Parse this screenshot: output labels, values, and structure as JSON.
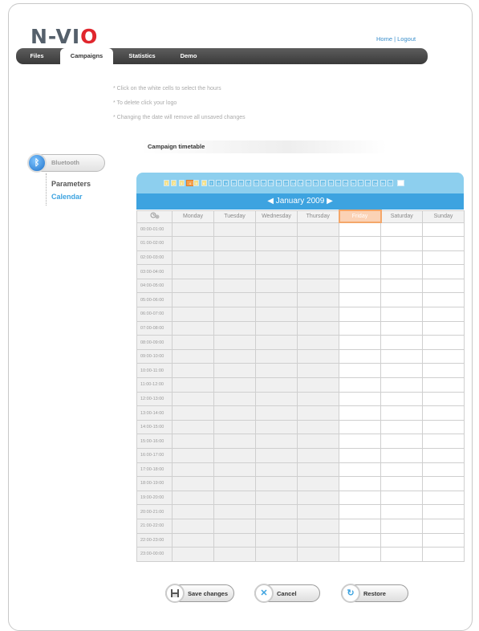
{
  "logo": {
    "pre": "N-VI",
    "o": "O"
  },
  "toplinks": {
    "home": "Home",
    "sep": " | ",
    "logout": "Logout"
  },
  "nav": {
    "tabs": [
      {
        "label": "Files"
      },
      {
        "label": "Campaigns"
      },
      {
        "label": "Statistics"
      },
      {
        "label": "Demo"
      }
    ],
    "active": "Campaigns"
  },
  "hints": [
    "* Click on the white cells to select the hours",
    "* To delete click your logo",
    "* Changing the date will remove all unsaved changes"
  ],
  "sidebar": {
    "pill_label": "Bluetooth",
    "items": [
      {
        "label": "Parameters"
      },
      {
        "label": "Calendar"
      }
    ]
  },
  "section_title": "Campaign timetable",
  "calendar": {
    "month": "January 2009",
    "prev_arrow": "◀",
    "next_arrow": "▶",
    "days": [
      "1",
      "2",
      "3",
      "4",
      "5",
      "6",
      "7",
      "8",
      "9",
      "10",
      "11",
      "12",
      "13",
      "14",
      "15",
      "16",
      "17",
      "18",
      "19",
      "20",
      "21",
      "22",
      "23",
      "24",
      "25",
      "26",
      "27",
      "28",
      "29",
      "30",
      "31"
    ],
    "selected_day": "4",
    "corner_icon": "clock-icon",
    "weekdays": [
      "Monday",
      "Tuesday",
      "Wednesday",
      "Thursday",
      "Friday",
      "Saturday",
      "Sunday"
    ],
    "highlight_weekday": "Friday",
    "hours": [
      "00:00-01:00",
      "01:00-02:00",
      "02:00-03:00",
      "03:00-04:00",
      "04:00-05:00",
      "05:00-06:00",
      "06:00-07:00",
      "07:00-08:00",
      "08:00-09:00",
      "09:00-10:00",
      "10:00-11:00",
      "11:00-12:00",
      "12:00-13:00",
      "13:00-14:00",
      "14:00-15:00",
      "15:00-16:00",
      "16:00-17:00",
      "17:00-18:00",
      "18:00-19:00",
      "19:00-20:00",
      "20:00-21:00",
      "21:00-22:00",
      "22:00-23:00",
      "23:00-00:00"
    ]
  },
  "buttons": {
    "save": "Save changes",
    "cancel": "Cancel",
    "restore": "Restore"
  },
  "colors": {
    "accent": "#3da3e0",
    "strip": "#8dcfee",
    "day_yellow": "#f3e08a",
    "day_selected": "#f4a04d",
    "day_blue": "#6fc0e8",
    "logo_red": "#e0262d"
  }
}
